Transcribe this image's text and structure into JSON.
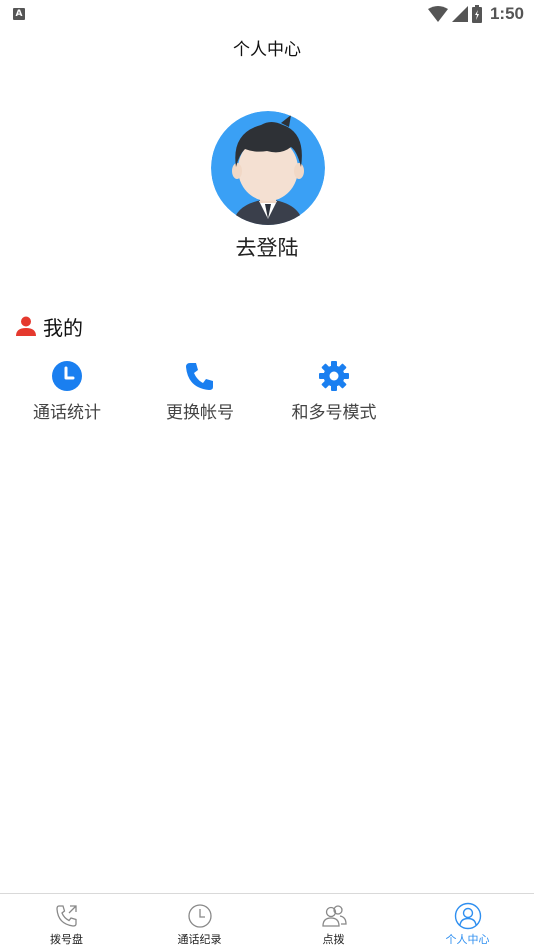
{
  "status_bar": {
    "time": "1:50",
    "indicator": "A"
  },
  "header": {
    "title": "个人中心"
  },
  "profile": {
    "login_label": "去登陆"
  },
  "section": {
    "title": "我的"
  },
  "menu": [
    {
      "label": "通话统计",
      "icon": "clock-icon"
    },
    {
      "label": "更换帐号",
      "icon": "phone-icon"
    },
    {
      "label": "和多号模式",
      "icon": "gear-icon"
    }
  ],
  "tabs": [
    {
      "label": "拨号盘",
      "icon": "dialpad-phone-icon"
    },
    {
      "label": "通话纪录",
      "icon": "history-clock-icon"
    },
    {
      "label": "点拨",
      "icon": "contacts-icon"
    },
    {
      "label": "个人中心",
      "icon": "profile-icon",
      "active": true
    }
  ],
  "colors": {
    "accent": "#2f8ff0",
    "icon_blue": "#1a7ff0",
    "person_red": "#e5392e",
    "avatar_bg": "#3aa0f5"
  }
}
